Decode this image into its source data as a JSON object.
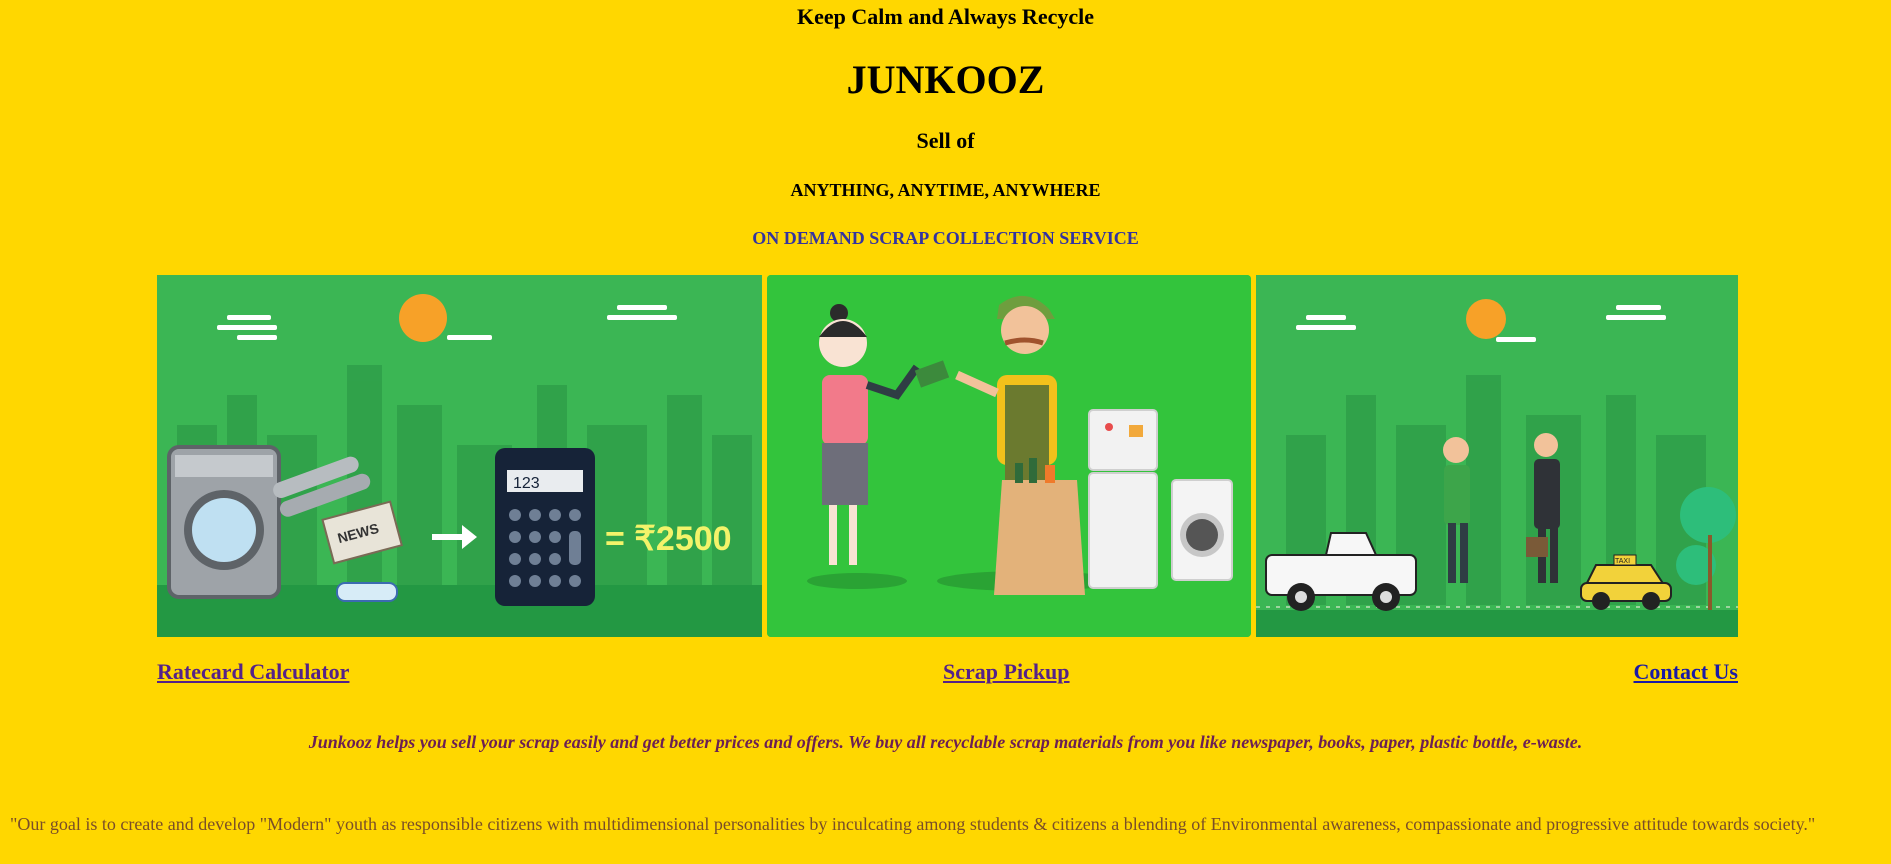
{
  "header": {
    "tagline": "Keep Calm and Always Recycle",
    "brand": "JUNKOOZ",
    "sell_of": "Sell of",
    "anything": "ANYTHING, ANYTIME, ANYWHERE",
    "service": "ON DEMAND SCRAP COLLECTION SERVICE"
  },
  "banners": [
    {
      "name": "ratecard-banner",
      "calculator_display": "123",
      "price": "= ₹2500",
      "newspaper_label": "NEWS",
      "icon": "washing-machine-calculator-illustration"
    },
    {
      "name": "pickup-banner",
      "icon": "scrap-dealer-handing-cash-illustration"
    },
    {
      "name": "contact-banner",
      "taxi_label": "TAXI",
      "icon": "pickup-truck-handshake-illustration"
    }
  ],
  "links": {
    "ratecard": "Ratecard Calculator",
    "pickup": "Scrap Pickup",
    "contact": "Contact Us"
  },
  "about": "Junkooz helps you sell your scrap easily and get better prices and offers. We buy all recyclable scrap materials from you like newspaper, books, paper, plastic bottle, e-waste.",
  "goal": "\"Our goal is to create and develop \"Modern\" youth as responsible citizens with multidimensional personalities by inculcating among students & citizens a blending of Environmental awareness, compassionate and progressive attitude towards society.\"",
  "colors": {
    "background": "#FFD700",
    "banner_green": "#2EA94F",
    "link_visited": "#552288",
    "link": "#1A1AA6",
    "service_text": "#3333A0",
    "about_text": "#6B1F55",
    "goal_text": "#7A4E28"
  }
}
